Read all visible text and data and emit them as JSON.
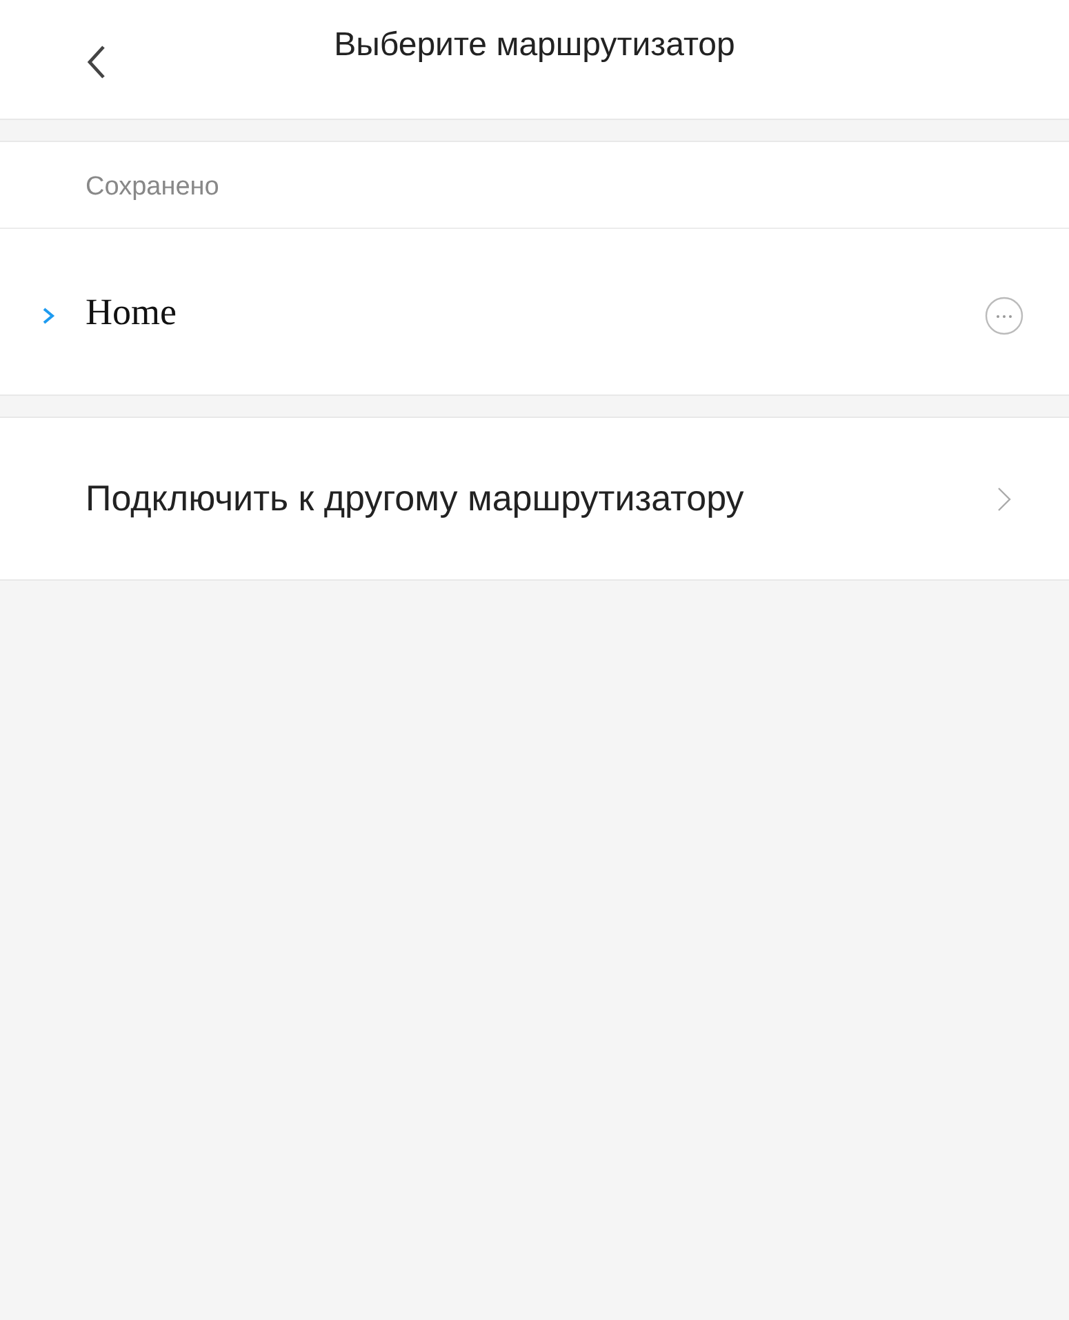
{
  "header": {
    "title": "Выберите маршрутизатор"
  },
  "saved_section": {
    "label": "Сохранено",
    "networks": [
      {
        "name": "Home",
        "selected": true
      }
    ]
  },
  "other_router": {
    "label": "Подключить к другому маршрутизатору"
  }
}
